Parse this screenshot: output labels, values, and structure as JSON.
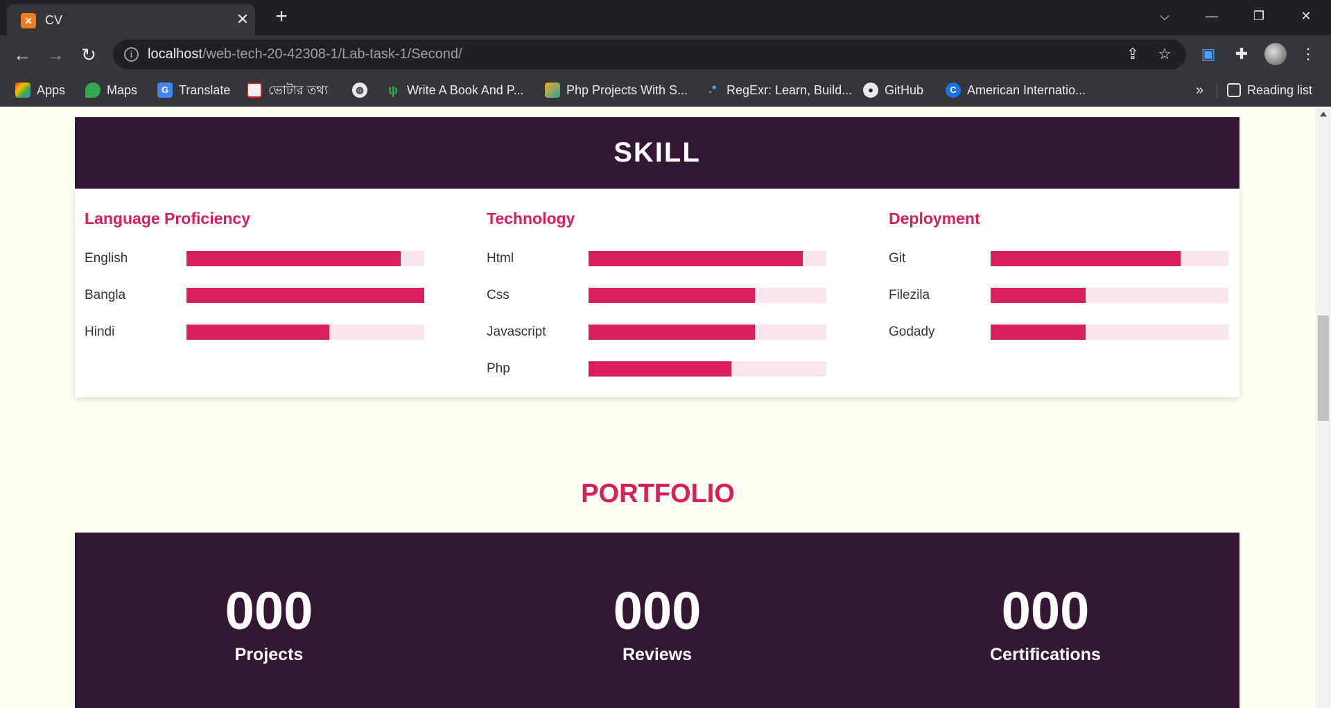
{
  "browser": {
    "tab_title": "CV",
    "url_host": "localhost",
    "url_path": "/web-tech-20-42308-1/Lab-task-1/Second/",
    "bookmarks": [
      "Apps",
      "Maps",
      "Translate",
      "ভোটার তথ্য",
      "",
      "Write A Book And P...",
      "Php Projects With S...",
      "RegExr: Learn, Build...",
      "GitHub",
      "American Internatio..."
    ],
    "overflow": "»",
    "reading_list": "Reading list"
  },
  "skill": {
    "title": "SKILL",
    "columns": [
      {
        "title": "Language Proficiency",
        "items": [
          {
            "name": "English",
            "level": 0.9
          },
          {
            "name": "Bangla",
            "level": 1.0
          },
          {
            "name": "Hindi",
            "level": 0.6
          }
        ]
      },
      {
        "title": "Technology",
        "items": [
          {
            "name": "Html",
            "level": 0.9
          },
          {
            "name": "Css",
            "level": 0.7
          },
          {
            "name": "Javascript",
            "level": 0.7
          },
          {
            "name": "Php",
            "level": 0.6
          }
        ]
      },
      {
        "title": "Deployment",
        "items": [
          {
            "name": "Git",
            "level": 0.8
          },
          {
            "name": "Filezila",
            "level": 0.4
          },
          {
            "name": "Godady",
            "level": 0.4
          }
        ]
      }
    ]
  },
  "portfolio": {
    "title": "PORTFOLIO",
    "stats": [
      {
        "value": "000",
        "label": "Projects"
      },
      {
        "value": "000",
        "label": "Reviews"
      },
      {
        "value": "000",
        "label": "Certifications"
      }
    ]
  },
  "colors": {
    "accent": "#d81f5c",
    "dark": "#331832",
    "background": "#fdfff2",
    "bar_track": "#f9e6ee"
  }
}
